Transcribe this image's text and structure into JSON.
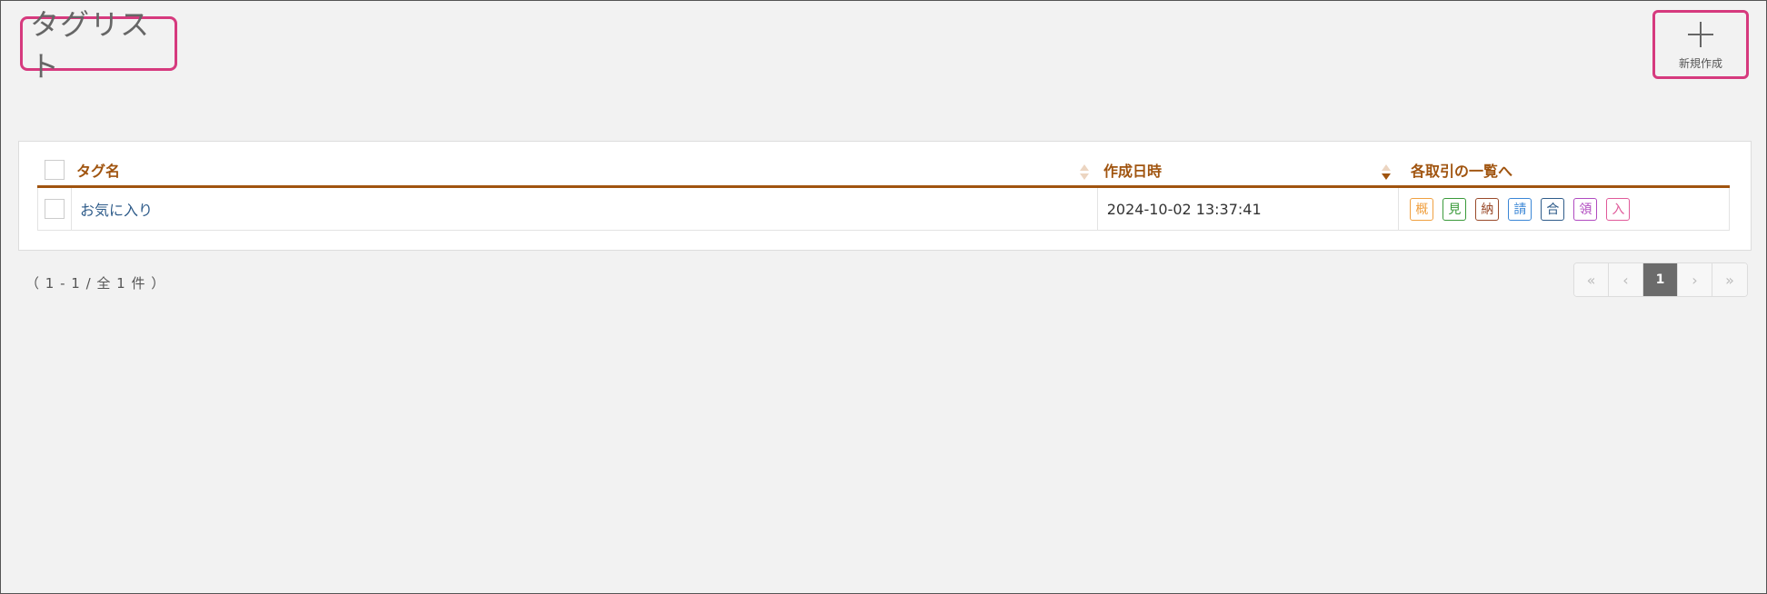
{
  "header": {
    "title": "タグリスト",
    "new_button_label": "新規作成",
    "new_button_icon": "plus-icon"
  },
  "table": {
    "columns": [
      "タグ名",
      "作成日時",
      "各取引の一覧へ"
    ],
    "rows": [
      {
        "name": "お気に入り",
        "created_at": "2024-10-02 13:37:41",
        "links": [
          {
            "label": "概",
            "color": "#f0a040"
          },
          {
            "label": "見",
            "color": "#3a9a3a"
          },
          {
            "label": "納",
            "color": "#9a4a2a"
          },
          {
            "label": "請",
            "color": "#3a86d6"
          },
          {
            "label": "合",
            "color": "#2f5c8a"
          },
          {
            "label": "領",
            "color": "#b04ac0"
          },
          {
            "label": "入",
            "color": "#e05a9a"
          }
        ]
      }
    ]
  },
  "pagination": {
    "summary": "（ 1 - 1 / 全 1 件 ）",
    "first": "«",
    "prev": "‹",
    "current": "1",
    "next": "›",
    "last": "»"
  },
  "colors": {
    "accent": "#a0540f",
    "highlight_border": "#d63a7e",
    "link": "#2f5c8a"
  }
}
